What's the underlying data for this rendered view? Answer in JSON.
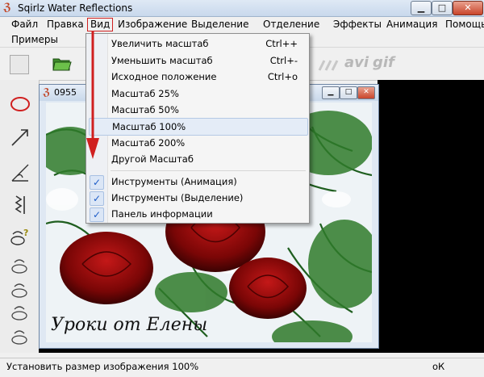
{
  "window": {
    "title": "Sqirlz Water Reflections",
    "icon": "sqirlz-app-icon"
  },
  "title_buttons": {
    "minimize": "▁",
    "maximize": "□",
    "close": "✕"
  },
  "menubar": {
    "items": [
      "Файл",
      "Правка",
      "Вид",
      "Изображение",
      "Выделение",
      "Отделение",
      "Эффекты",
      "Анимация",
      "Помощь"
    ],
    "second_row": [
      "Примеры"
    ],
    "active": "Вид"
  },
  "toolbar": {
    "text_buttons": [
      "avi",
      "gif"
    ]
  },
  "child_window": {
    "title": "0955",
    "caption": "Уроки от Елены"
  },
  "view_menu": {
    "items": [
      {
        "label": "Увеличить масштаб",
        "shortcut": "Ctrl++",
        "checked": false
      },
      {
        "label": "Уменьшить масштаб",
        "shortcut": "Ctrl+-",
        "checked": false
      },
      {
        "label": "Исходное положение",
        "shortcut": "Ctrl+o",
        "checked": false
      },
      {
        "label": "Масштаб  25%",
        "shortcut": "",
        "checked": false
      },
      {
        "label": "Масштаб  50%",
        "shortcut": "",
        "checked": false
      },
      {
        "label": "Масштаб  100%",
        "shortcut": "",
        "checked": false,
        "highlighted": true
      },
      {
        "label": "Масштаб  200%",
        "shortcut": "",
        "checked": false
      },
      {
        "label": "Другой Масштаб",
        "shortcut": "",
        "checked": false
      },
      {
        "label": "Инструменты (Анимация)",
        "shortcut": "",
        "checked": true
      },
      {
        "label": "Инструменты (Выделение)",
        "shortcut": "",
        "checked": true
      },
      {
        "label": "Панель информации",
        "shortcut": "",
        "checked": true
      }
    ]
  },
  "statusbar": {
    "text": "Установить размер изображения 100%",
    "right": "оК"
  },
  "colors": {
    "accent_red": "#d02020",
    "check_blue": "#1d5cc8",
    "canvas_black": "#000000"
  }
}
